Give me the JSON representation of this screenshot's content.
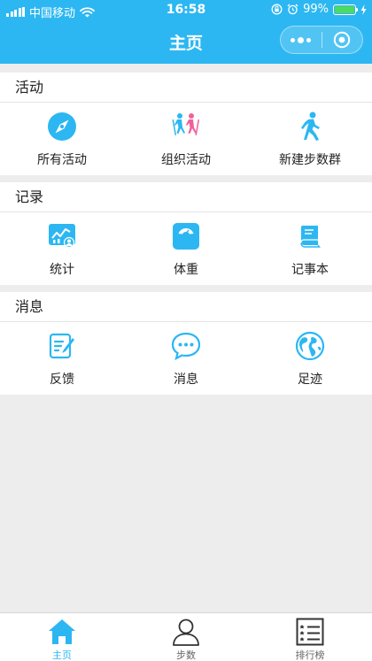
{
  "status_bar": {
    "carrier": "中国移动",
    "time": "16:58",
    "battery_percent": "99%",
    "battery_level": 0.99,
    "icons": [
      "signal-icon",
      "wifi-icon",
      "orientation-lock-icon",
      "alarm-icon",
      "battery-icon",
      "charging-icon"
    ]
  },
  "nav": {
    "title": "主页",
    "menu_icon": "more-dots-icon",
    "close_icon": "target-circle-icon"
  },
  "sections": [
    {
      "title": "活动",
      "items": [
        {
          "label": "所有活动",
          "icon": "compass-icon"
        },
        {
          "label": "组织活动",
          "icon": "hikers-icon"
        },
        {
          "label": "新建步数群",
          "icon": "walking-person-icon"
        }
      ]
    },
    {
      "title": "记录",
      "items": [
        {
          "label": "统计",
          "icon": "stats-chart-icon"
        },
        {
          "label": "体重",
          "icon": "weight-scale-icon"
        },
        {
          "label": "记事本",
          "icon": "notebook-icon"
        }
      ]
    },
    {
      "title": "消息",
      "items": [
        {
          "label": "反馈",
          "icon": "edit-note-icon"
        },
        {
          "label": "消息",
          "icon": "chat-bubble-icon"
        },
        {
          "label": "足迹",
          "icon": "globe-icon"
        }
      ]
    }
  ],
  "tabbar": [
    {
      "label": "主页",
      "icon": "home-icon",
      "active": true
    },
    {
      "label": "步数",
      "icon": "user-outline-icon",
      "active": false
    },
    {
      "label": "排行榜",
      "icon": "ranking-list-icon",
      "active": false
    }
  ],
  "colors": {
    "primary": "#2cb7f2",
    "background": "#ededed",
    "hiker_pink": "#f0619a",
    "battery_green": "#4cd964"
  }
}
